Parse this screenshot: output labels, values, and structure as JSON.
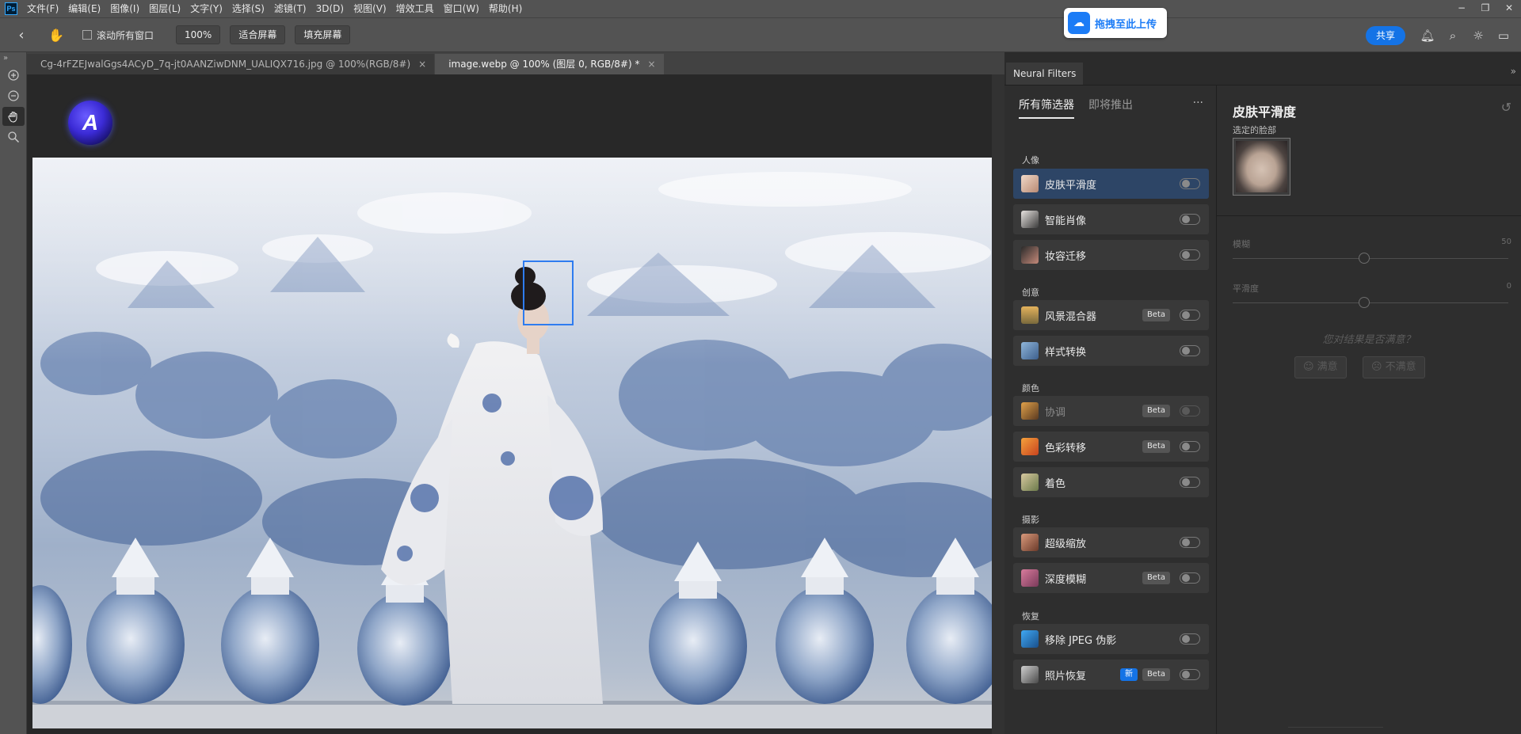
{
  "menubar": {
    "app_icon": "Ps",
    "items": [
      "文件(F)",
      "编辑(E)",
      "图像(I)",
      "图层(L)",
      "文字(Y)",
      "选择(S)",
      "滤镜(T)",
      "3D(D)",
      "视图(V)",
      "增效工具",
      "窗口(W)",
      "帮助(H)"
    ],
    "window_controls": [
      "minimize-icon",
      "restore-icon",
      "close-icon"
    ]
  },
  "upload_badge": {
    "label": "拖拽至此上传",
    "icon": "cloud-upload-icon"
  },
  "optbar": {
    "scroll_all_label": "滚动所有窗口",
    "zoom_value": "100%",
    "fit_screen": "适合屏幕",
    "fill_screen": "填充屏幕",
    "share": "共享",
    "icons": [
      "bell-icon",
      "search-icon",
      "lightbulb-icon",
      "workspace-icon"
    ]
  },
  "tabs": [
    {
      "title": "Cg-4rFZEJwalGgs4ACyD_7q-jt0AANZiwDNM_UALIQX716.jpg @ 100%(RGB/8#)",
      "active": false
    },
    {
      "title": "image.webp @ 100% (图层 0, RGB/8#) *",
      "active": true
    }
  ],
  "tab_close_glyph": "×",
  "tools": [
    "zoom-in-icon",
    "zoom-out-icon",
    "hand-icon",
    "magnifier-icon"
  ],
  "canvas": {
    "logo_letter": "A"
  },
  "neural_filters": {
    "panel_tab": "Neural Filters",
    "tab_all": "所有筛选器",
    "tab_coming": "即将推出",
    "more": "···",
    "categories": [
      {
        "name": "人像",
        "items": [
          {
            "label": "皮肤平滑度",
            "selected": true,
            "disabled": false,
            "badges": []
          },
          {
            "label": "智能肖像",
            "selected": false,
            "disabled": false,
            "badges": []
          },
          {
            "label": "妆容迁移",
            "selected": false,
            "disabled": false,
            "badges": []
          }
        ]
      },
      {
        "name": "创意",
        "items": [
          {
            "label": "风景混合器",
            "selected": false,
            "disabled": false,
            "badges": [
              "Beta"
            ]
          },
          {
            "label": "样式转换",
            "selected": false,
            "disabled": false,
            "badges": []
          }
        ]
      },
      {
        "name": "颜色",
        "items": [
          {
            "label": "协调",
            "selected": false,
            "disabled": true,
            "badges": [
              "Beta"
            ]
          },
          {
            "label": "色彩转移",
            "selected": false,
            "disabled": false,
            "badges": [
              "Beta"
            ]
          },
          {
            "label": "着色",
            "selected": false,
            "disabled": false,
            "badges": []
          }
        ]
      },
      {
        "name": "摄影",
        "items": [
          {
            "label": "超级缩放",
            "selected": false,
            "disabled": false,
            "badges": []
          },
          {
            "label": "深度模糊",
            "selected": false,
            "disabled": false,
            "badges": [
              "Beta"
            ]
          }
        ]
      },
      {
        "name": "恢复",
        "items": [
          {
            "label": "移除 JPEG 伪影",
            "selected": false,
            "disabled": false,
            "badges": []
          },
          {
            "label": "照片恢复",
            "selected": false,
            "disabled": false,
            "badges": [
              "新",
              "Beta"
            ]
          }
        ]
      }
    ]
  },
  "detail": {
    "title": "皮肤平滑度",
    "face_label": "选定的脸部",
    "sliders": [
      {
        "label": "模糊",
        "value": 50,
        "max": 100
      },
      {
        "label": "平滑度",
        "value": 0,
        "min": -50,
        "max": 50
      }
    ],
    "question": "您对结果是否满意？",
    "yes": "☺ 满意",
    "no": "☹ 不满意"
  }
}
